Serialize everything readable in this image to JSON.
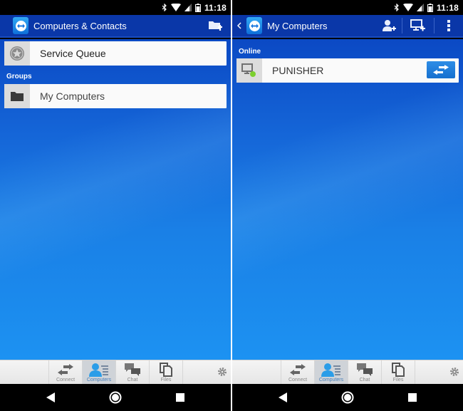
{
  "status_bar": {
    "time": "11:18",
    "icons": [
      "bluetooth-icon",
      "wifi-icon",
      "signal-icon",
      "battery-icon"
    ]
  },
  "colors": {
    "app_bar": "#0a37a8",
    "accent": "#1670cf",
    "online_dot": "#7ccf2e"
  },
  "left_screen": {
    "title": "Computers & Contacts",
    "action_icon": "add-group-folder-icon",
    "service_queue": {
      "label": "Service Queue",
      "icon": "star-badge-icon"
    },
    "groups_label": "Groups",
    "groups": [
      {
        "label": "My Computers",
        "icon": "folder-icon"
      }
    ]
  },
  "right_screen": {
    "title": "My Computers",
    "back_icon": "chevron-left-icon",
    "actions": [
      "add-contact-icon",
      "add-computer-icon",
      "more-vert-icon"
    ],
    "online_label": "Online",
    "computers": [
      {
        "name": "PUNISHER",
        "status": "online",
        "action": "connect-arrows-icon"
      }
    ]
  },
  "bottom_tabs": [
    {
      "label": "Connect",
      "icon": "connect-arrows-icon",
      "active": false
    },
    {
      "label": "Computers",
      "icon": "computers-contacts-icon",
      "active": true
    },
    {
      "label": "Chat",
      "icon": "chat-icon",
      "active": false
    },
    {
      "label": "Files",
      "icon": "files-icon",
      "active": false
    }
  ],
  "settings_icon": "gear-icon",
  "nav_bar": [
    "back-triangle-icon",
    "home-circle-icon",
    "recents-square-icon"
  ]
}
